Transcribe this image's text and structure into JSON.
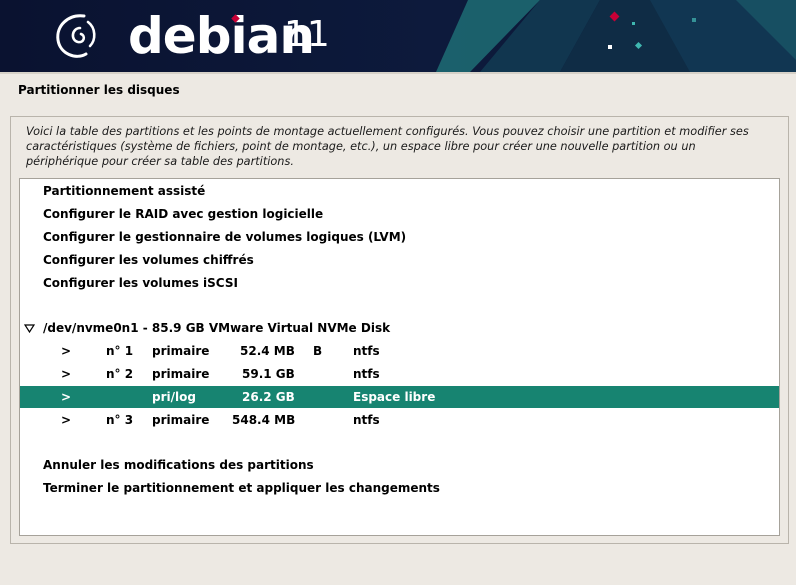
{
  "header": {
    "brand": "debian",
    "version": "11"
  },
  "page": {
    "title": "Partitionner les disques",
    "description": "Voici la table des partitions et les points de montage actuellement configurés. Vous pouvez choisir une partition et modifier ses caractéristiques (système de fichiers, point de montage, etc.), un espace libre pour créer une nouvelle partition ou un périphérique pour créer sa table des partitions."
  },
  "menu": {
    "assisted": "Partitionnement assisté",
    "raid": "Configurer le RAID avec gestion logicielle",
    "lvm": "Configurer le gestionnaire de volumes logiques (LVM)",
    "crypto": "Configurer les volumes chiffrés",
    "iscsi": "Configurer les volumes iSCSI",
    "undo": "Annuler les modifications des partitions",
    "finish": "Terminer le partitionnement et appliquer les changements"
  },
  "disk": {
    "label": "/dev/nvme0n1 - 85.9 GB VMware Virtual NVMe Disk",
    "partitions": [
      {
        "arrow": ">",
        "num": "n° 1",
        "type": "primaire",
        "size": "52.4 MB",
        "flag": "B",
        "fs": "ntfs"
      },
      {
        "arrow": ">",
        "num": "n° 2",
        "type": "primaire",
        "size": "59.1 GB",
        "flag": "",
        "fs": "ntfs"
      },
      {
        "arrow": ">",
        "num": "",
        "type": "pri/log",
        "size": "26.2 GB",
        "flag": "",
        "fs": "Espace libre"
      },
      {
        "arrow": ">",
        "num": "n° 3",
        "type": "primaire",
        "size": "548.4 MB",
        "flag": "",
        "fs": "ntfs"
      }
    ]
  },
  "colors": {
    "selection": "#178471",
    "banner": "#0c1530",
    "accent_teal": "#1f6d74",
    "logo_dot": "#c70036"
  }
}
